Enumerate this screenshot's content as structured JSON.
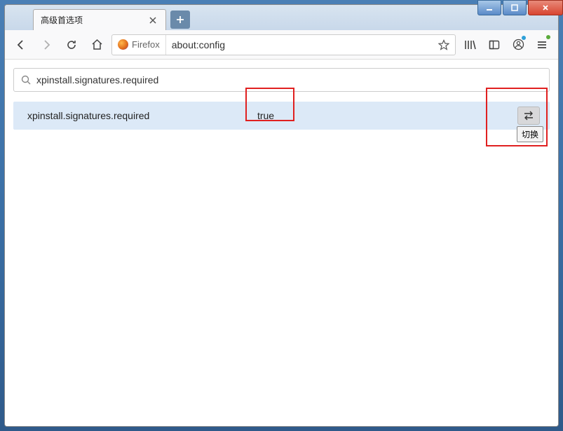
{
  "window": {
    "title": "高级首选项"
  },
  "toolbar": {
    "identity_label": "Firefox",
    "url": "about:config"
  },
  "search": {
    "value": "xpinstall.signatures.required"
  },
  "pref": {
    "name": "xpinstall.signatures.required",
    "value": "true"
  },
  "tooltip": {
    "toggle": "切换"
  }
}
